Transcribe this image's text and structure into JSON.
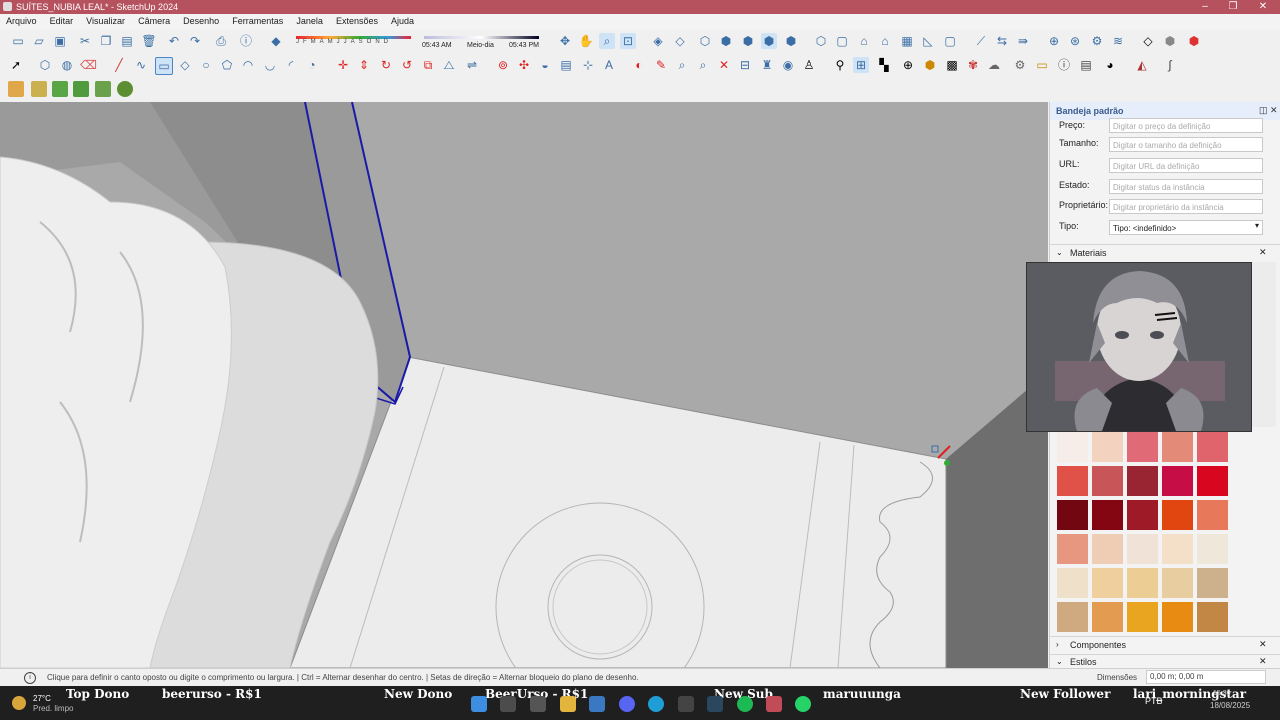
{
  "window": {
    "title": "SUÍTES_NUBIA LEAL* - SketchUp 2024"
  },
  "menu": [
    "Arquivo",
    "Editar",
    "Visualizar",
    "Câmera",
    "Desenho",
    "Ferramentas",
    "Janela",
    "Extensões",
    "Ajuda"
  ],
  "shadow": {
    "months": "JFMAMJJASOND",
    "time_start": "05:43 AM",
    "time_mid": "Meio-dia",
    "time_end": "05:43 PM"
  },
  "tray": {
    "title": "Bandeja padrão",
    "fields": [
      {
        "label": "Preço:",
        "placeholder": "Digitar o preço da definição"
      },
      {
        "label": "Tamanho:",
        "placeholder": "Digitar o tamanho da definição"
      },
      {
        "label": "URL:",
        "placeholder": "Digitar URL da definição"
      },
      {
        "label": "Estado:",
        "placeholder": "Digitar status da instância"
      },
      {
        "label": "Proprietário:",
        "placeholder": "Digitar proprietário da instância"
      }
    ],
    "type_label": "Tipo:",
    "type_value": "Tipo: <indefinido>",
    "materials_title": "Materiais",
    "components_title": "Componentes",
    "styles_title": "Estilos"
  },
  "swatches": [
    "#f6ece8",
    "#f3d3c0",
    "#e06a75",
    "#e38a78",
    "#e0646c",
    "#e05148",
    "#c85558",
    "#982531",
    "#c70d46",
    "#d8061e",
    "#720611",
    "#850613",
    "#9e1a27",
    "#e14510",
    "#e7785a",
    "#e7977f",
    "#eecdb4",
    "#f0e2d7",
    "#f4e0c8",
    "#efe7da",
    "#efe1c9",
    "#efcf9d",
    "#eccd93",
    "#e8cda1",
    "#cdb08c",
    "#cfaa80",
    "#e39b51",
    "#e9a420",
    "#e88b12",
    "#c28744"
  ],
  "status": {
    "hint": "Clique para definir o canto oposto ou digite o comprimento ou largura. | Ctrl = Alternar desenhar do centro. | Setas de direção = Alternar bloqueio do plano de desenho.",
    "dim_label": "Dimensões",
    "dim_value": "0,00 m; 0,00 m"
  },
  "taskbar": {
    "weather_temp": "27°C",
    "weather_desc": "Pred. limpo",
    "tickers": [
      {
        "label": "Top Dono"
      },
      {
        "label": "beerurso - R$1"
      },
      {
        "label": "New Dono"
      },
      {
        "label": "BeerUrso - R$1"
      },
      {
        "label": "New Sub"
      },
      {
        "label": "maruuunga"
      },
      {
        "label": "New Follower"
      },
      {
        "label": "lari_morningstar"
      }
    ],
    "lang": "PTB",
    "date": "18/08/2025",
    "time": "15:36"
  },
  "colors": {
    "accent": "#b5525e",
    "selection": "#1a1aa8",
    "canvas_bg": "#a9a9a9"
  }
}
